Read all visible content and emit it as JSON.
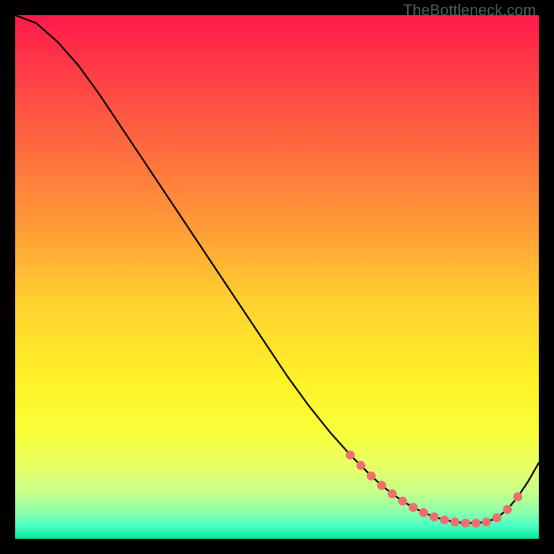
{
  "watermark": "TheBottleneck.com",
  "chart_data": {
    "type": "line",
    "title": "",
    "xlabel": "",
    "ylabel": "",
    "xlim": [
      0,
      100
    ],
    "ylim": [
      0,
      100
    ],
    "x": [
      0,
      4,
      8,
      12,
      16,
      20,
      24,
      28,
      32,
      36,
      40,
      44,
      48,
      52,
      56,
      60,
      64,
      66,
      68,
      70,
      72,
      74,
      76,
      78,
      80,
      82,
      84,
      86,
      88,
      90,
      92,
      94,
      96,
      98,
      100
    ],
    "values": [
      100,
      98.5,
      95,
      90.5,
      85,
      79,
      73,
      67,
      61,
      55,
      49,
      43,
      37,
      31,
      25.5,
      20.5,
      16,
      14,
      12,
      10.2,
      8.6,
      7.2,
      6,
      5,
      4.2,
      3.6,
      3.2,
      3,
      3,
      3.2,
      4,
      5.6,
      8,
      11,
      14.5
    ],
    "markers_x": [
      64,
      66,
      68,
      70,
      72,
      74,
      76,
      78,
      80,
      82,
      84,
      86,
      88,
      90,
      92,
      94,
      96
    ],
    "markers_y": [
      16,
      14,
      12,
      10.2,
      8.6,
      7.2,
      6,
      5,
      4.2,
      3.6,
      3.2,
      3,
      3,
      3.2,
      4,
      5.6,
      8
    ],
    "gradient_stops": [
      {
        "offset": 0.0,
        "color": "#ff1a4b"
      },
      {
        "offset": 0.1,
        "color": "#ff3a47"
      },
      {
        "offset": 0.25,
        "color": "#ff6a3f"
      },
      {
        "offset": 0.4,
        "color": "#ff9a37"
      },
      {
        "offset": 0.55,
        "color": "#ffd22f"
      },
      {
        "offset": 0.7,
        "color": "#fff227"
      },
      {
        "offset": 0.8,
        "color": "#f8ff3a"
      },
      {
        "offset": 0.86,
        "color": "#e8ff66"
      },
      {
        "offset": 0.91,
        "color": "#c8ff88"
      },
      {
        "offset": 0.95,
        "color": "#8cffad"
      },
      {
        "offset": 0.975,
        "color": "#4affc2"
      },
      {
        "offset": 1.0,
        "color": "#00e8a0"
      }
    ]
  }
}
